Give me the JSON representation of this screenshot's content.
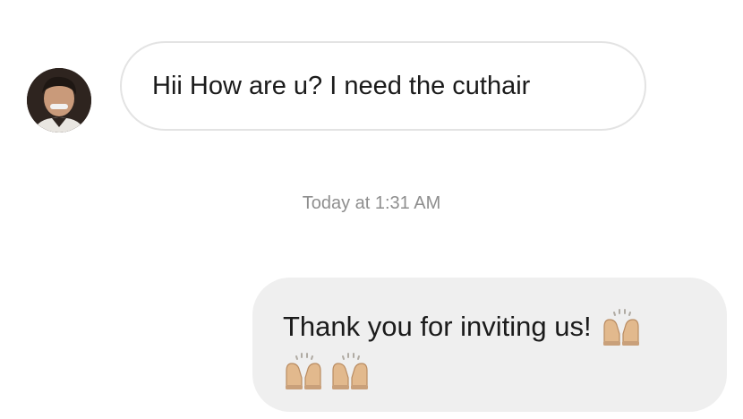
{
  "thread": {
    "incoming": {
      "avatar_icon": "user-avatar-photo",
      "text": "Hii How are u? I need the cuthair"
    },
    "timestamp": "Today at 1:31 AM",
    "outgoing": {
      "text": "Thank you for inviting us!",
      "emoji": [
        "raising-hands-emoji",
        "raising-hands-emoji",
        "raising-hands-emoji"
      ]
    }
  },
  "colors": {
    "incoming_bubble_border": "#e3e3e3",
    "outgoing_bubble_bg": "#efefef",
    "timestamp_text": "#8e8e8e",
    "emoji_skin": "#e2b98d"
  }
}
